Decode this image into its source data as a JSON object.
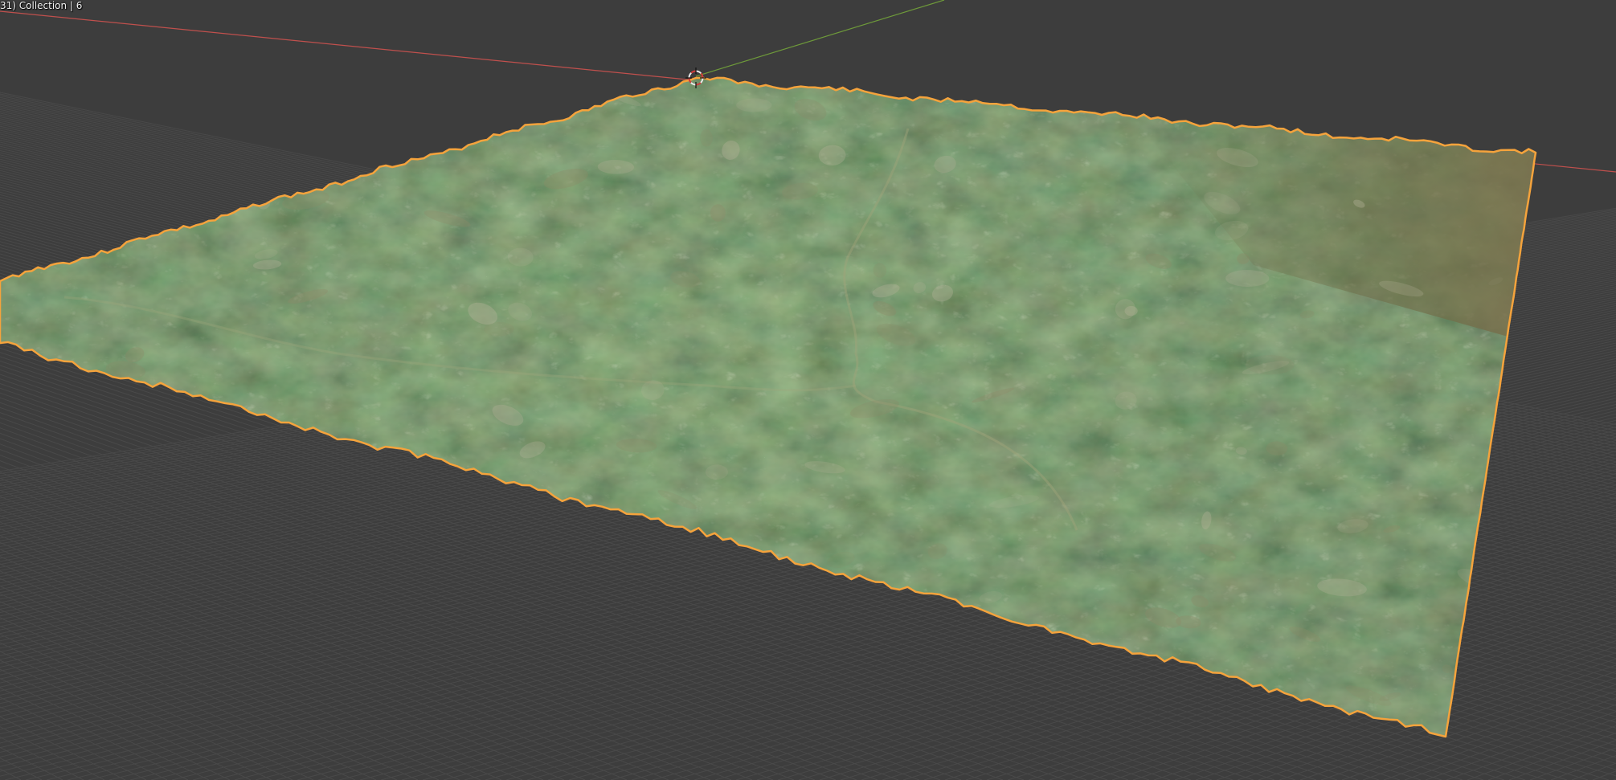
{
  "viewport": {
    "overlay_text": "31) Collection | 6",
    "background_color": "#3d3d3d",
    "grid_color": "#4a4a4a",
    "x_axis_color": "#c0504d",
    "y_axis_color": "#6e9a3a",
    "selection_outline_color": "#f5a33c"
  },
  "scene": {
    "object": "terrain-mesh",
    "selected": true,
    "cursor_icon": "3d-cursor-icon"
  }
}
